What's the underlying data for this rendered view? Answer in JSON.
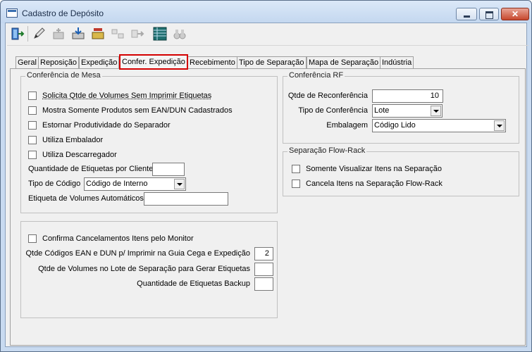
{
  "window": {
    "title": "Cadastro de Depósito",
    "close_label": "✕"
  },
  "toolbar": {
    "icons": [
      "exit-icon",
      "edit-icon",
      "new-icon",
      "save-icon",
      "open-icon",
      "transfer-icon",
      "export-icon",
      "grid-icon",
      "binoculars-icon"
    ]
  },
  "tabs": [
    {
      "label": "Geral"
    },
    {
      "label": "Reposição"
    },
    {
      "label": "Expedição"
    },
    {
      "label": "Confer. Expedição"
    },
    {
      "label": "Recebimento"
    },
    {
      "label": "Tipo de Separação"
    },
    {
      "label": "Mapa de Separação"
    },
    {
      "label": "Indústria"
    }
  ],
  "conferencia_mesa": {
    "legend": "Conferência de Mesa",
    "checkboxes": [
      {
        "label": "Solicita Qtde de Volumes Sem Imprimir Etiquetas"
      },
      {
        "label": "Mostra Somente Produtos sem EAN/DUN Cadastrados"
      },
      {
        "label": "Estornar Produtividade do Separador"
      },
      {
        "label": "Utiliza Embalador"
      },
      {
        "label": "Utiliza Descarregador"
      }
    ],
    "qtd_etiquetas_label": "Quantidade de Etiquetas por Cliente",
    "qtd_etiquetas_value": "",
    "tipo_codigo_label": "Tipo de Código",
    "tipo_codigo_value": "Código de Interno",
    "etiqueta_volumes_label": "Etiqueta de Volumes Automáticos",
    "etiqueta_volumes_value": ""
  },
  "outros": {
    "confirma_label": "Confirma Cancelamentos Itens pelo Monitor",
    "qtd_ean_label": "Qtde Códigos EAN e DUN p/ Imprimir na Guia Cega e Expedição",
    "qtd_ean_value": "2",
    "qtd_volumes_label": "Qtde de Volumes no Lote de Separação para Gerar Etiquetas",
    "qtd_volumes_value": "",
    "qtd_backup_label": "Quantidade de Etiquetas Backup",
    "qtd_backup_value": ""
  },
  "conferencia_rf": {
    "legend": "Conferência RF",
    "qtde_reconf_label": "Qtde de Reconferência",
    "qtde_reconf_value": "10",
    "tipo_conf_label": "Tipo de Conferência",
    "tipo_conf_value": "Lote",
    "embalagem_label": "Embalagem",
    "embalagem_value": "Código Lido"
  },
  "flow_rack": {
    "legend": "Separação Flow-Rack",
    "checkboxes": [
      {
        "label": "Somente Visualizar Itens na Separação"
      },
      {
        "label": "Cancela Itens na Separação Flow-Rack"
      }
    ]
  },
  "colors": {
    "active_tab_border": "#d40000",
    "frame": "#c8daf0"
  }
}
